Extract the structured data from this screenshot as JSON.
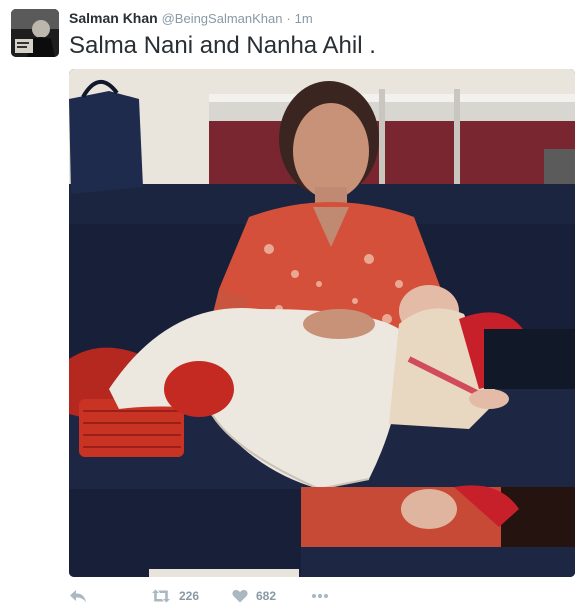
{
  "tweet": {
    "author_name": "Salman Khan",
    "author_handle": "@BeingSalmanKhan",
    "separator": "·",
    "time": "1m",
    "text": "Salma Nani and Nanha Ahil ."
  },
  "actions": {
    "reply_icon": "reply-icon",
    "retweet_icon": "retweet-icon",
    "retweet_count": "226",
    "like_icon": "heart-icon",
    "like_count": "682",
    "more_icon": "more-dots-icon"
  },
  "colors": {
    "text": "#292f33",
    "muted": "#8899a6",
    "icon": "#aab8c2"
  }
}
